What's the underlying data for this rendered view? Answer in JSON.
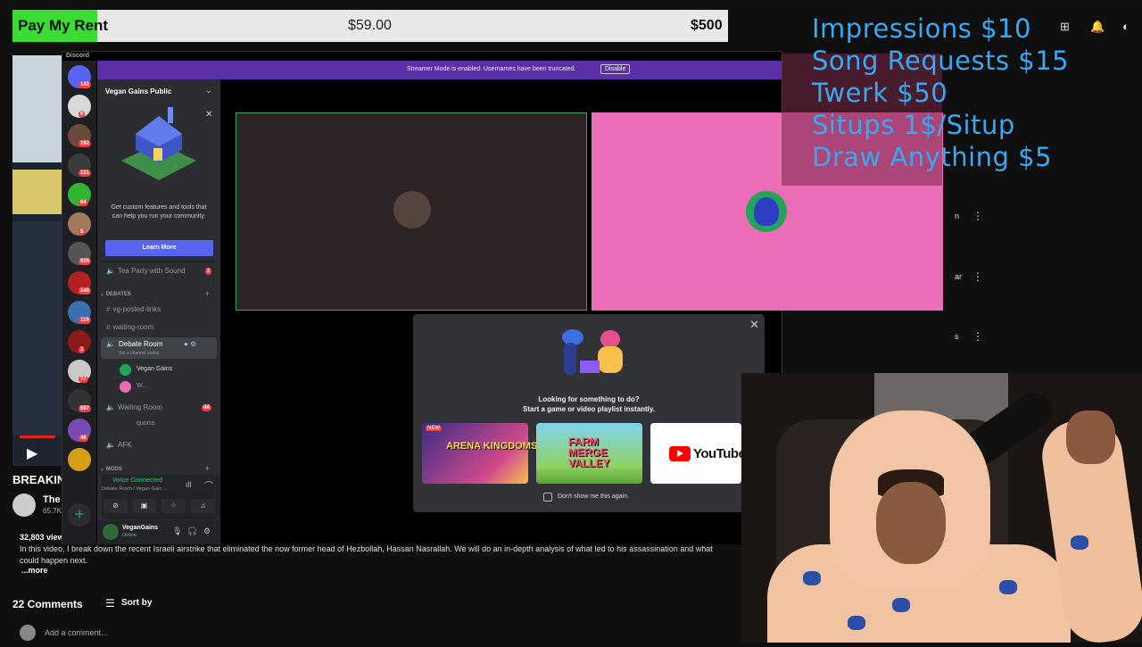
{
  "donation_bar": {
    "label": "Pay My Rent",
    "current": "$59.00",
    "goal": "$500",
    "progress_fraction": 0.118,
    "fill_color": "#3bdc34"
  },
  "overlay_menu": [
    "Impressions $10",
    "Song Requests $15",
    "Twerk $50",
    "Situps 1$/Situp",
    "Draw Anything $5"
  ],
  "youtube": {
    "title": "BREAKIN",
    "channel": "The",
    "subs": "65.7K",
    "views": "32,803 views",
    "description": "In this video, I break down the recent Israeli airstrike that eliminated the now former head of Hezbollah, Hassan Nasrallah. We will do an in-depth analysis of what led to his assassination and what could happen next.",
    "more": "...more",
    "comments_count": "22 Comments",
    "sort_by": "Sort by",
    "add_comment_placeholder": "Add a comment..."
  },
  "discord": {
    "window_title": "Discord",
    "streamer_mode_text": "Streamer Mode is enabled. Usernames have been truncated.",
    "disable_button": "Disable",
    "server_name": "Vegan Gains Public",
    "promo_text": "Get custom features and tools that can help you run your community.",
    "learn_more": "Learn More",
    "server_badges": [
      "142",
      "9",
      "192",
      "121",
      "64",
      "8",
      "929",
      "146",
      "119",
      "1",
      "77",
      "897",
      "46"
    ],
    "channels": {
      "tea_party": "Tea Party with Sound",
      "tea_party_badge": "1",
      "category_debates": "DEBATES",
      "vg_posted_links": "vg-posted-links",
      "waiting_room_text": "waiting-room",
      "debate_room": "Debate Room",
      "channel_status": "Set a channel status",
      "vc_user1": "Vegan Gains",
      "vc_user2": "W...",
      "waiting_room_voice": "Waiting Room",
      "waiting_room_badge": "44",
      "waiting_user": "quorra",
      "afk": "AFK",
      "category_mods": "MODS"
    },
    "voice": {
      "status": "Voice Connected",
      "location": "Debate Room / Vegan Gain..."
    },
    "user": {
      "name": "VeganGains",
      "status": "Online"
    },
    "activities": {
      "title": "Looking for something to do?",
      "subtitle": "Start a game or video playlist instantly.",
      "new_badge": "NEW",
      "items": [
        "ARENA KINGDOMS",
        "FARM MERGE VALLEY",
        "YouTube"
      ],
      "dont_show": "Don't show me this again."
    }
  },
  "right_column": {
    "rows": [
      "n",
      "ar",
      "s"
    ]
  },
  "colors": {
    "discord_blurple": "#5865f2",
    "streamer_banner": "#5b2fa8",
    "voice_green": "#23a559",
    "menu_blue": "#3aa8f0",
    "tile_pink": "#eb6cb7"
  }
}
